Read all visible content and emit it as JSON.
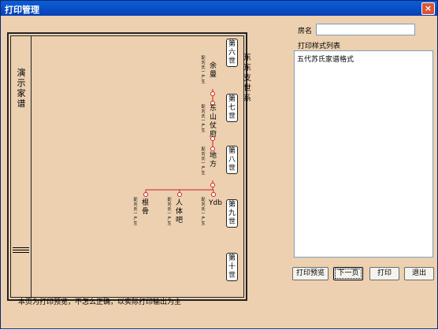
{
  "window": {
    "title": "打印管理",
    "close_label": "×"
  },
  "preview": {
    "title": "演示家谱",
    "series_title": "东东支世系",
    "generations": [
      "第六世",
      "第七世",
      "第八世",
      "第九世",
      "第十世"
    ],
    "people": [
      {
        "name": "余曼",
        "note": "配刘氏一产生"
      },
      {
        "name": "东山仗府",
        "note": "配刘氏一产生"
      },
      {
        "name": "地方",
        "note": "配刘氏一产生"
      },
      {
        "name": "Ydb",
        "note": "配刘氏一产生"
      },
      {
        "name": "人体吧",
        "note": "配刘氏一产生"
      },
      {
        "name": "根骨",
        "note": "配刘氏一产生"
      }
    ]
  },
  "room": {
    "label": "房名",
    "value": ""
  },
  "styles": {
    "label": "打印样式列表",
    "items": [
      "五代苏氏家谱格式"
    ]
  },
  "buttons": {
    "preview": "打印预览",
    "next": "下一页",
    "print": "打印",
    "exit": "退出"
  },
  "footnote": "本页为打印预览，不怎么正确，以实际打印输出为主",
  "colors": {
    "page_bg": "#ecd0b0",
    "line": "#d02020",
    "titlebar": "#0a5fd6"
  }
}
